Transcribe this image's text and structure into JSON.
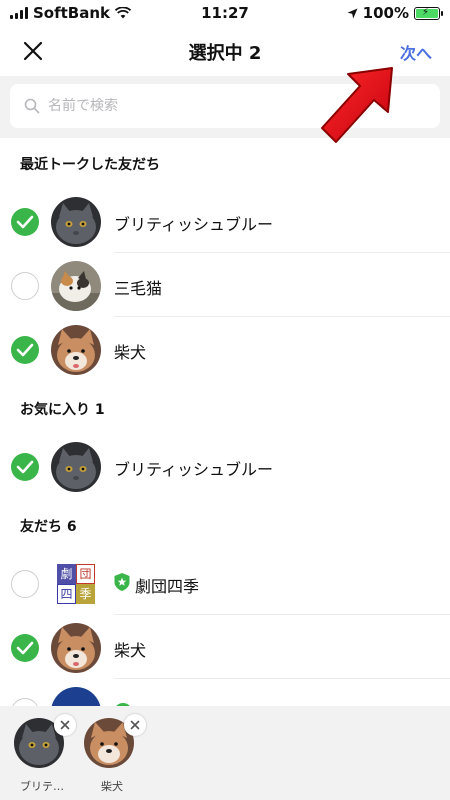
{
  "status_bar": {
    "carrier": "SoftBank",
    "time": "11:27",
    "battery": "100%"
  },
  "header": {
    "title": "選択中 2",
    "next_label": "次へ"
  },
  "search": {
    "placeholder": "名前で検索"
  },
  "sections": {
    "recent_title": "最近トークした友だち",
    "favorites_title": "お気に入り 1",
    "friends_title": "友だち 6"
  },
  "recent": [
    {
      "name": "ブリティッシュブルー",
      "selected": true,
      "avatar": "gray-cat"
    },
    {
      "name": "三毛猫",
      "selected": false,
      "avatar": "calico-cat"
    },
    {
      "name": "柴犬",
      "selected": true,
      "avatar": "shiba-dog"
    }
  ],
  "favorites": [
    {
      "name": "ブリティッシュブルー",
      "selected": true,
      "avatar": "gray-cat"
    }
  ],
  "friends": [
    {
      "name": "劇団四季",
      "selected": false,
      "avatar": "shiki-logo",
      "verified": true,
      "logo_chars": [
        "劇",
        "団",
        "四",
        "季"
      ]
    },
    {
      "name": "柴犬",
      "selected": true,
      "avatar": "shiba-dog"
    }
  ],
  "selected_tray": [
    {
      "name": "ブリテ…",
      "avatar": "gray-cat"
    },
    {
      "name": "柴犬",
      "avatar": "shiba-dog"
    }
  ],
  "colors": {
    "accent": "#4a6fe0",
    "check": "#3ab54a",
    "verified_badge": "#3ab54a",
    "annotation_arrow": "#e8001c"
  }
}
